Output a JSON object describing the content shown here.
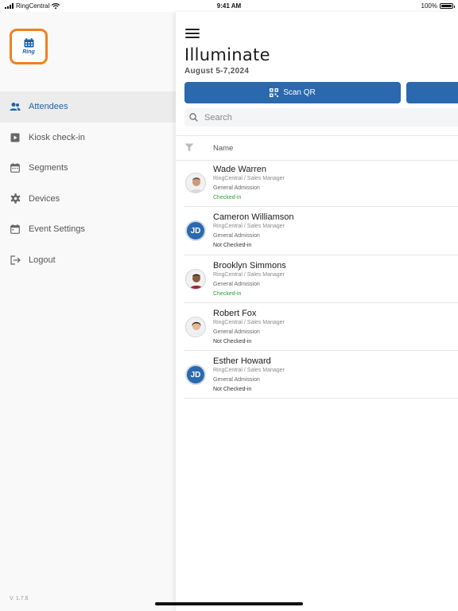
{
  "status_bar": {
    "carrier": "RingCentral",
    "time": "9:41 AM",
    "battery": "100%"
  },
  "sidebar": {
    "logo_text": "Ring",
    "items": [
      {
        "label": "Attendees",
        "icon": "people-icon",
        "active": true
      },
      {
        "label": "Kiosk check-in",
        "icon": "kiosk-icon",
        "active": false
      },
      {
        "label": "Segments",
        "icon": "calendar-icon",
        "active": false
      },
      {
        "label": "Devices",
        "icon": "gear-icon",
        "active": false
      },
      {
        "label": "Event Settings",
        "icon": "calendar-icon",
        "active": false
      },
      {
        "label": "Logout",
        "icon": "logout-icon",
        "active": false
      }
    ],
    "version": "V. 1.7.6"
  },
  "main": {
    "title": "Illuminate",
    "date": "August 5-7,2024",
    "scan_button": "Scan QR",
    "search_placeholder": "Search",
    "column_name": "Name",
    "attendees": [
      {
        "name": "Wade Warren",
        "company": "RingCentral / Sales Manager",
        "ticket": "General Admission",
        "status": "Checked-in",
        "checked": true,
        "avatar": "photo"
      },
      {
        "name": "Cameron Williamson",
        "company": "RingCentral / Sales Manager",
        "ticket": "General Admission",
        "status": "Not Checked-in",
        "checked": false,
        "avatar": "JD"
      },
      {
        "name": "Brooklyn Simmons",
        "company": "RingCentral / Sales Manager",
        "ticket": "General Admission",
        "status": "Checked-in",
        "checked": true,
        "avatar": "photo"
      },
      {
        "name": "Robert Fox",
        "company": "RingCentral / Sales Manager",
        "ticket": "General Admission",
        "status": "Not Checked-in",
        "checked": false,
        "avatar": "photo"
      },
      {
        "name": "Esther Howard",
        "company": "RingCentral / Sales Manager",
        "ticket": "General Admission",
        "status": "Not Checked-in",
        "checked": false,
        "avatar": "JD"
      }
    ]
  },
  "colors": {
    "accent": "#2a69ad",
    "logo_border": "#f2801f",
    "checked": "#2e9b3a"
  }
}
